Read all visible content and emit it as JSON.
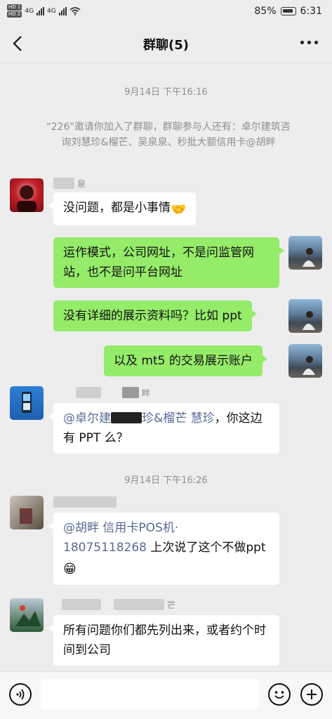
{
  "status_bar": {
    "hd1": "HD 1",
    "hd2": "HD 2",
    "net1": "4G",
    "net2": "4G",
    "battery": "85%",
    "time": "6:31"
  },
  "header": {
    "title": "群聊(5)"
  },
  "messages": {
    "time1": "9月14日 下午16:16",
    "system": "\"226\"邀请你加入了群聊，群聊参与人还有：卓尔建筑咨询刘慧珍&榴芒、吴泉泉、秒批大额信用卡@胡畔",
    "m1_sender": "泉",
    "m1_text": "没问题，都是小事情",
    "m1_emoji": "🤝",
    "m2_text": "运作模式，公司网址，不是问监管网站，也不是问平台网址",
    "m3_text": "没有详细的展示资料吗？比如 ppt",
    "m4_text": "以及 mt5 的交易展示账户",
    "m5_sender": "畔",
    "m5_mention": "@卓尔建",
    "m5_mention_tail": "珍&榴芒 慧珍",
    "m5_text": "，你这边有 PPT 么？",
    "time2": "9月14日 下午16:26",
    "m6_mention": "@胡畔 信用卡POS机·",
    "m6_phone": "18075118268",
    "m6_text": " 上次说了这个不做ppt",
    "m6_emoji": "😁",
    "m7_sender": "芒",
    "m7_text": "所有问题你们都先列出来，或者约个时间到公司"
  },
  "colors": {
    "background": "#ededed",
    "outgoing_bubble": "#95ec69",
    "incoming_bubble": "#ffffff",
    "link": "#576b95"
  },
  "icons": [
    "back-arrow-icon",
    "more-dots-icon",
    "voice-icon",
    "emoji-icon",
    "plus-icon"
  ]
}
